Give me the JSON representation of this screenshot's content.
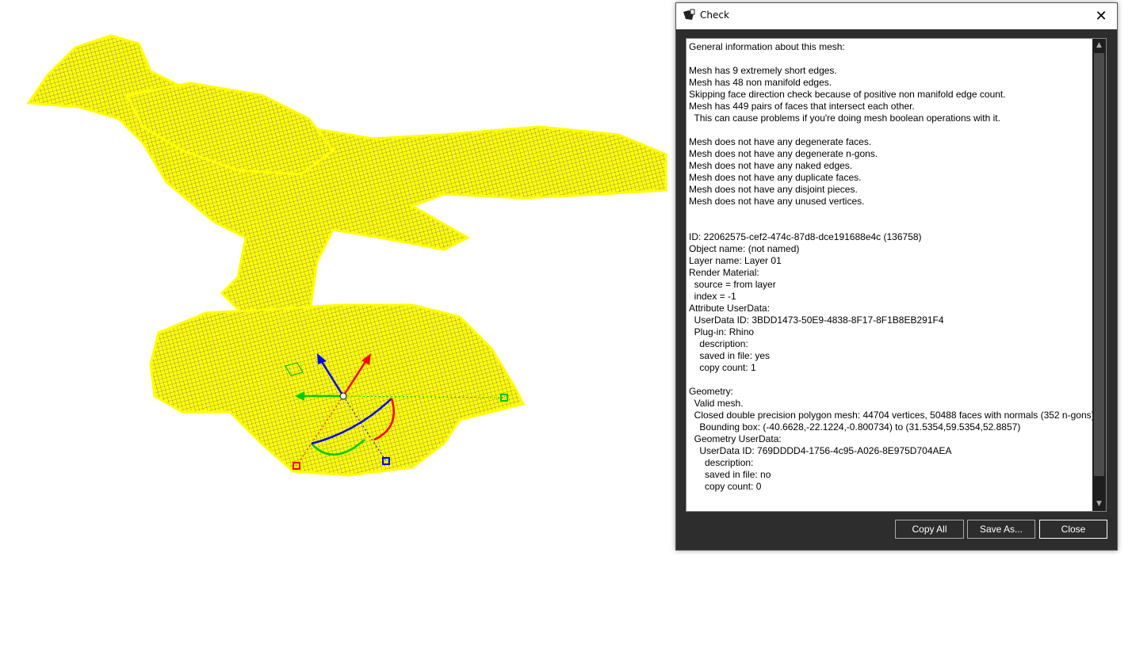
{
  "dialog": {
    "title": "Check",
    "close_glyph": "✕",
    "lines": [
      "General information about this mesh:",
      "",
      "Mesh has 9 extremely short edges.",
      "Mesh has 48 non manifold edges.",
      "Skipping face direction check because of positive non manifold edge count.",
      "Mesh has 449 pairs of faces that intersect each other.",
      "  This can cause problems if you're doing mesh boolean operations with it.",
      "",
      "Mesh does not have any degenerate faces.",
      "Mesh does not have any degenerate n-gons.",
      "Mesh does not have any naked edges.",
      "Mesh does not have any duplicate faces.",
      "Mesh does not have any disjoint pieces.",
      "Mesh does not have any unused vertices.",
      "",
      "",
      "ID: 22062575-cef2-474c-87d8-dce191688e4c (136758)",
      "Object name: (not named)",
      "Layer name: Layer 01",
      "Render Material:",
      "  source = from layer",
      "  index = -1",
      "Attribute UserData:",
      "  UserData ID: 3BDD1473-50E9-4838-8F17-8F1B8EB291F4",
      "  Plug-in: Rhino",
      "    description:",
      "    saved in file: yes",
      "    copy count: 1",
      "",
      "Geometry:",
      "  Valid mesh.",
      "  Closed double precision polygon mesh: 44704 vertices, 50488 faces with normals (352 n-gons)",
      "    Bounding box: (-40.6628,-22.1224,-0.800734) to (31.5354,59.5354,52.8857)",
      "  Geometry UserData:",
      "    UserData ID: 769DDDD4-1756-4c95-A026-8E975D704AEA",
      "      description:",
      "      saved in file: no",
      "      copy count: 0"
    ],
    "buttons": {
      "copy_all": "Copy All",
      "save_as": "Save As...",
      "close": "Close"
    }
  },
  "viewport": {
    "mesh_color": "#ffff00",
    "gumball_colors": {
      "x": "#ff0000",
      "y": "#00cc00",
      "z": "#0000ff"
    }
  }
}
